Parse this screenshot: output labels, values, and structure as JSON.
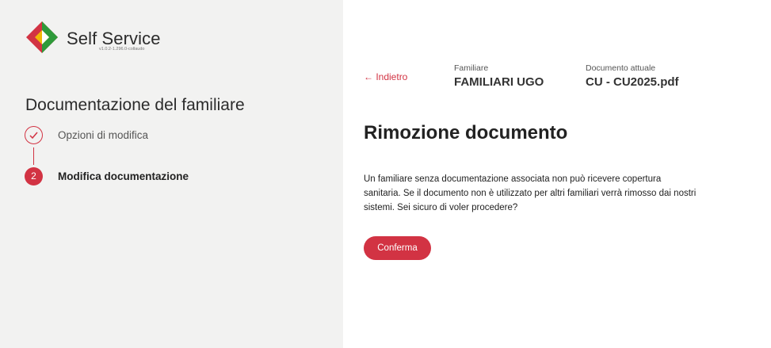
{
  "brand": {
    "title": "Self Service",
    "version": "v1.0.2-1.296.0-collaudo",
    "logo_icon": "diamond-logo-icon",
    "logo_colors": [
      "#d23343",
      "#2e9a3a",
      "#f2b705"
    ]
  },
  "sidebar": {
    "section_title": "Documentazione del familiare",
    "steps": [
      {
        "number": "✓",
        "label": "Opzioni di modifica",
        "status": "completed",
        "icon": "check-icon"
      },
      {
        "number": "2",
        "label": "Modifica documentazione",
        "status": "active"
      }
    ]
  },
  "header": {
    "back_label": "← Indietro",
    "familiare_label": "Familiare",
    "familiare_value": "FAMILIARI UGO",
    "documento_label": "Documento attuale",
    "documento_value": "CU - CU2025.pdf"
  },
  "main": {
    "title": "Rimozione documento",
    "body": "Un familiare senza documentazione associata non può ricevere copertura sanitaria. Se il documento non è utilizzato per altri familiari verrà rimosso dai nostri sistemi. Sei sicuro di voler procedere?",
    "confirm_label": "Conferma"
  },
  "colors": {
    "accent": "#d23343",
    "sidebar_bg": "#f2f2f1",
    "main_bg": "#ffffff"
  }
}
